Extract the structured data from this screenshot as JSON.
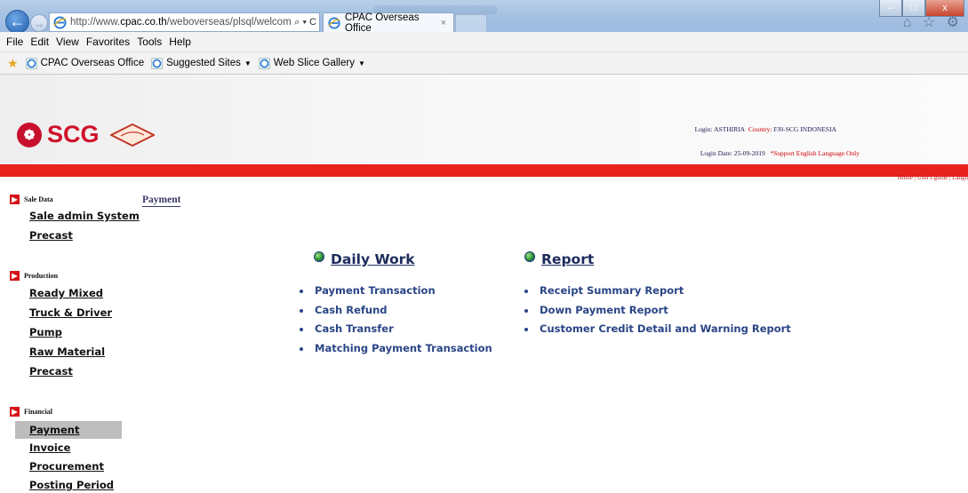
{
  "browser": {
    "url_domain": "http://www.",
    "url_host": "cpac.co.th",
    "url_path": "/weboverseas/plsql/welcome_c",
    "address_controls": "⌕ ▾ C",
    "tab_title": "CPAC Overseas Office",
    "tab_close": "×",
    "menu": [
      "File",
      "Edit",
      "View",
      "Favorites",
      "Tools",
      "Help"
    ],
    "favorites": [
      {
        "label": "CPAC Overseas Office",
        "has_dropdown": false
      },
      {
        "label": "Suggested Sites",
        "has_dropdown": true
      },
      {
        "label": "Web Slice Gallery",
        "has_dropdown": true
      }
    ],
    "window_buttons": [
      "–",
      "□",
      "x"
    ],
    "tool_icons": "⌂ ☆ ⚙"
  },
  "header": {
    "brand": "SCG",
    "login_line1": {
      "label_login": "Login:",
      "login_value": "ASTHIRIA",
      "label_country": "Country:",
      "country_value": "FJ0-SCG INDONESIA"
    },
    "login_line2": {
      "label_date": "Login Date:",
      "date_value": "25-09-2019",
      "support_note": "*Support English Language Only"
    },
    "top_links": "Home | User's guide | Langu"
  },
  "sidebar": {
    "sections": [
      {
        "title": "Sale Data",
        "items": [
          "Sale admin System",
          "Precast"
        ]
      },
      {
        "title": "Production",
        "items": [
          "Ready Mixed",
          "Truck & Driver",
          "Pump",
          "Raw Material",
          "Precast"
        ]
      },
      {
        "title": "Financial",
        "items": [
          "Payment",
          "Invoice",
          "Procurement",
          "Posting Period"
        ]
      }
    ],
    "active_item": "Payment"
  },
  "main": {
    "breadcrumb": "Payment",
    "daily_work": {
      "title": "Daily Work",
      "links": [
        "Payment Transaction",
        "Cash Refund",
        "Cash Transfer",
        "Matching Payment Transaction"
      ]
    },
    "report": {
      "title": "Report",
      "links": [
        "Receipt Summary Report",
        "Down Payment Report",
        "Customer Credit Detail and Warning Report"
      ]
    }
  }
}
